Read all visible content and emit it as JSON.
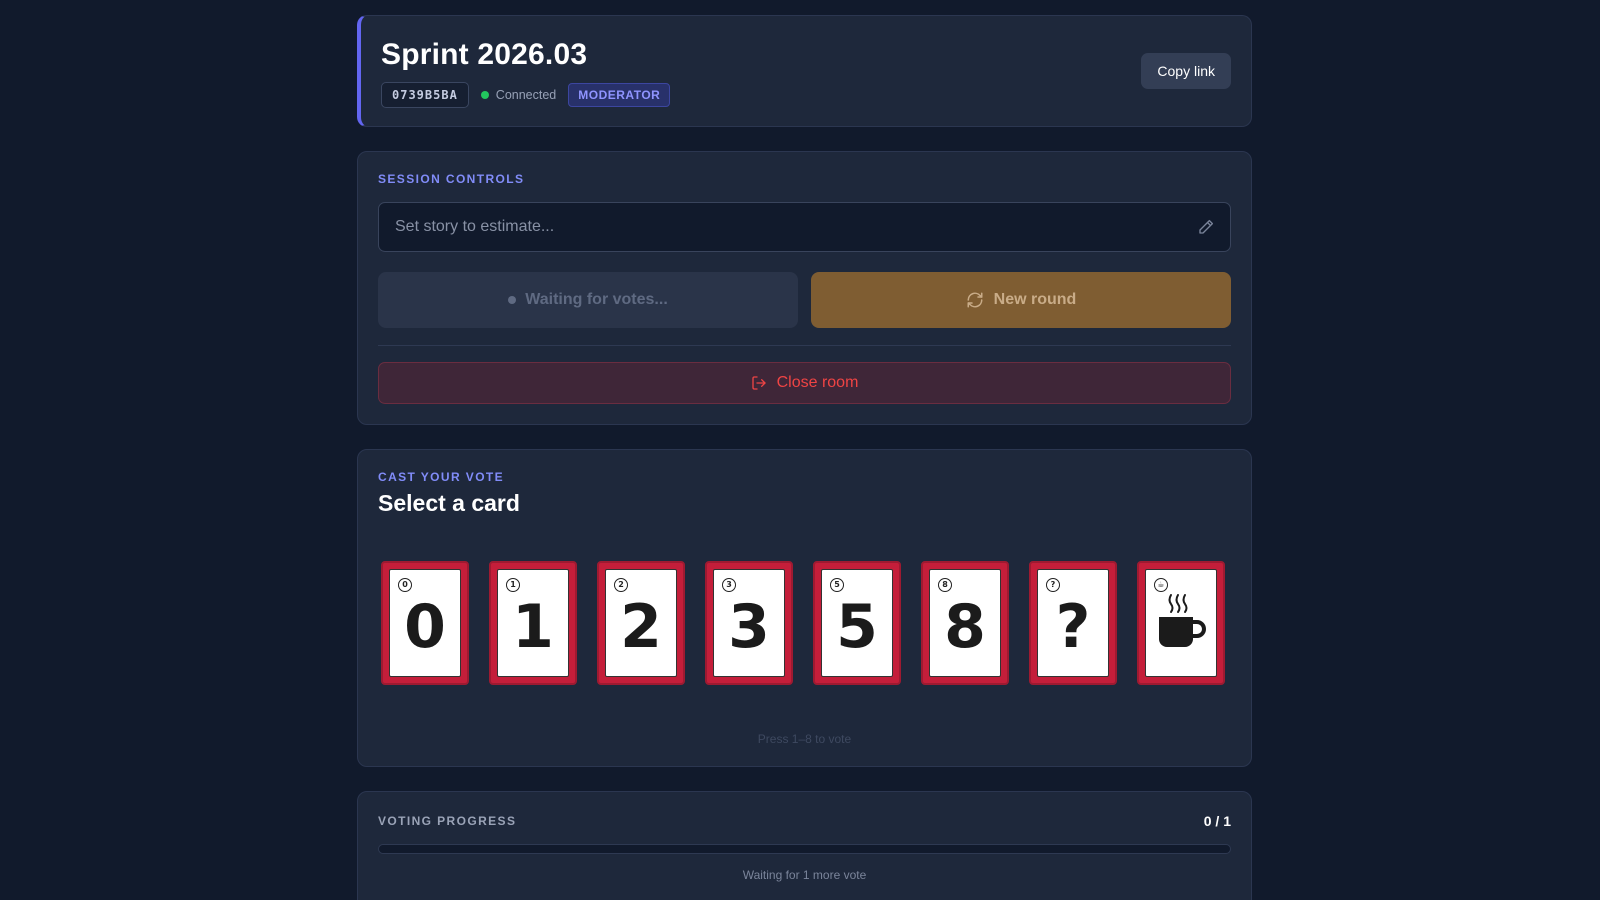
{
  "header": {
    "title": "Sprint 2026.03",
    "room_code": "0739B5BA",
    "connection_status": "Connected",
    "role_badge": "MODERATOR",
    "copy_link_label": "Copy link",
    "accent_color": "#6366f1"
  },
  "session_controls": {
    "section_label": "SESSION CONTROLS",
    "story_input": {
      "value": "",
      "placeholder": "Set story to estimate..."
    },
    "waiting_label": "Waiting for votes...",
    "new_round_label": "New round",
    "close_room_label": "Close room"
  },
  "vote": {
    "section_label": "CAST YOUR VOTE",
    "heading": "Select a card",
    "cards": [
      {
        "value": "0",
        "corner": "0",
        "icon": ""
      },
      {
        "value": "1",
        "corner": "1",
        "icon": ""
      },
      {
        "value": "2",
        "corner": "2",
        "icon": ""
      },
      {
        "value": "3",
        "corner": "3",
        "icon": ""
      },
      {
        "value": "5",
        "corner": "5",
        "icon": ""
      },
      {
        "value": "8",
        "corner": "8",
        "icon": ""
      },
      {
        "value": "?",
        "corner": "?",
        "icon": ""
      },
      {
        "value": "",
        "corner": "☕",
        "icon": "coffee-cup-icon"
      }
    ],
    "card_color": "#c41e3a",
    "hint": "Press 1–8 to vote"
  },
  "progress": {
    "section_label": "VOTING PROGRESS",
    "count": "0 / 1",
    "votes_cast": 0,
    "voters_total": 1,
    "status": "Waiting for 1 more vote"
  }
}
